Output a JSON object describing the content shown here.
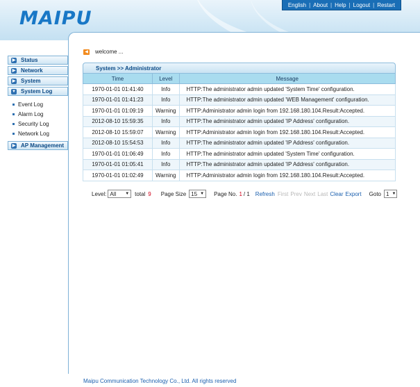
{
  "brand": {
    "logo": "MAIPU"
  },
  "topnav": {
    "items": [
      "English",
      "About",
      "Help",
      "Logout",
      "Restart"
    ]
  },
  "leftnav": {
    "status": "Status",
    "network": "Network",
    "system": "System",
    "system_log": "System Log",
    "sub": [
      "Event Log",
      "Alarm Log",
      "Security Log",
      "Network Log"
    ],
    "ap_management": "AP Management"
  },
  "welcome": "welcome ...",
  "breadcrumb": "System >> Administrator",
  "table": {
    "headers": [
      "Time",
      "Level",
      "Message"
    ],
    "rows": [
      [
        "1970-01-01 01:41:40",
        "Info",
        "HTTP:The administrator admin updated 'System Time' configuration."
      ],
      [
        "1970-01-01 01:41:23",
        "Info",
        "HTTP:The administrator admin updated 'WEB Management' configuration."
      ],
      [
        "1970-01-01 01:09:19",
        "Warning",
        "HTTP:Administrator admin login from 192.168.180.104.Result:Accepted."
      ],
      [
        "2012-08-10 15:59:35",
        "Info",
        "HTTP:The administrator admin updated 'IP Address' configuration."
      ],
      [
        "2012-08-10 15:59:07",
        "Warning",
        "HTTP:Administrator admin login from 192.168.180.104.Result:Accepted."
      ],
      [
        "2012-08-10 15:54:53",
        "Info",
        "HTTP:The administrator admin updated 'IP Address' configuration."
      ],
      [
        "1970-01-01 01:06:49",
        "Info",
        "HTTP:The administrator admin updated 'System Time' configuration."
      ],
      [
        "1970-01-01 01:05:41",
        "Info",
        "HTTP:The administrator admin updated 'IP Address' configuration."
      ],
      [
        "1970-01-01 01:02:49",
        "Warning",
        "HTTP:Administrator admin login from 192.168.180.104.Result:Accepted."
      ]
    ]
  },
  "pager": {
    "level_label": "Level:",
    "level_value": "All",
    "total_label": "total",
    "total_value": "9",
    "page_size_label": "Page Size",
    "page_size_value": "15",
    "page_no_label": "Page No.",
    "page_current": "1",
    "page_total": "/ 1",
    "refresh": "Refresh",
    "first": "First",
    "prev": "Prev",
    "next": "Next",
    "last": "Last",
    "clear": "Clear",
    "export": "Export",
    "goto_label": "Goto",
    "goto_value": "1"
  },
  "footer": "Maipu Communication Technology Co., Ltd. All rights reserved",
  "colors": {
    "brand_blue": "#1877c6",
    "nav_blue": "#1a6eb6",
    "header_row": "#a9dcef",
    "alert_red": "#d0021b",
    "warn_icon": "#f28a1d"
  }
}
